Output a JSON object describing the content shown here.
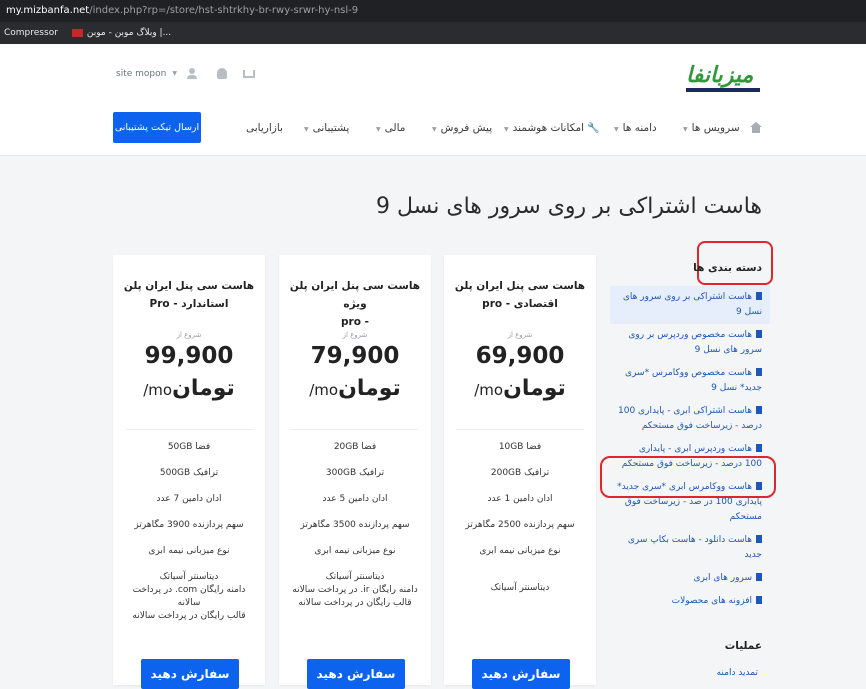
{
  "browser": {
    "url_host": "my.mizbanfa.net",
    "url_path": "/index.php?rp=/store/hst-shtrkhy-br-rwy-srwr-hy-nsl-9"
  },
  "bookmarks": [
    {
      "label": "Compressor"
    },
    {
      "label": "وبلاگ موبن - موبن |..."
    }
  ],
  "header": {
    "logo_text": "میزبانفا",
    "account_label": "site mopon",
    "ticket_button": "ارسال تیکت پشتیبانی",
    "nav": [
      {
        "label": "سرویس ها",
        "has_caret": true
      },
      {
        "label": "دامنه ها",
        "has_caret": true
      },
      {
        "label": "امکانات هوشمند",
        "has_caret": true
      },
      {
        "label": "پیش فروش",
        "has_caret": true
      },
      {
        "label": "مالی",
        "has_caret": true
      },
      {
        "label": "پشتیبانی",
        "has_caret": true
      },
      {
        "label": "بازاریابی",
        "has_caret": false
      }
    ]
  },
  "page": {
    "title": "هاست اشتراکی بر روی سرور های نسل 9"
  },
  "sidebar": {
    "categories_heading": "دسته بندی ها",
    "categories": [
      {
        "label": "هاست اشتراکی بر روی سرور های نسل 9",
        "active": true
      },
      {
        "label": "هاست مخصوص وردپرس بر روی سرور های نسل 9",
        "active": false
      },
      {
        "label": "هاست مخصوص ووکامرس *سری جدید* نسل 9",
        "active": false
      },
      {
        "label": "هاست اشتراکی ابری - پایداری 100 درصد - زیرساخت فوق مستحکم",
        "active": false
      },
      {
        "label": "هاست وردپرس ابری - پایداری 100 درصد - زیرساخت فوق مستحکم",
        "active": false
      },
      {
        "label": "هاست ووکامرس ابری *سری جدید* پایداری 100 در صد - زیرساخت فوق مستحکم",
        "active": false
      },
      {
        "label": "هاست دانلود - هاست بکاپ سری جدید",
        "active": false
      },
      {
        "label": "سرور های ابری",
        "active": false
      },
      {
        "label": "افزونه های محصولات",
        "active": false
      }
    ],
    "ops_heading": "عملیات",
    "ops_item": "تمدید دامنه"
  },
  "products": [
    {
      "title_line1": "هاست سی پنل ایران پلن",
      "title_line2": "اقتصادی - pro",
      "from_label": "شروع از",
      "price": "69,900",
      "currency": "تومان",
      "period": "/mo",
      "features": [
        "فضا 10GB",
        "ترافیک 200GB",
        "ادان دامین 1 عدد",
        "سهم پردازنده 2500 مگاهرتز",
        "نوع میزبانی نیمه ابری",
        "دیتاسنتر آسیاتک"
      ],
      "order_label": "سفارش دهید"
    },
    {
      "title_line1": "هاست سی پنل ایران پلن ویژه",
      "title_line2": "- pro",
      "from_label": "شروع از",
      "price": "79,900",
      "currency": "تومان",
      "period": "/mo",
      "features": [
        "فضا 20GB",
        "ترافیک 300GB",
        "ادان دامین 5 عدد",
        "سهم پردازنده 3500 مگاهرتز",
        "نوع میزبانی نیمه ابری",
        "دیتاسنتر آسیاتک",
        "دامنه رایگان ir. در پرداخت سالانه",
        "قالب رایگان در پرداخت سالانه"
      ],
      "order_label": "سفارش دهید"
    },
    {
      "title_line1": "هاست سی پنل ایران پلن",
      "title_line2": "استاندارد - Pro",
      "from_label": "شروع از",
      "price": "99,900",
      "currency": "تومان",
      "period": "/mo",
      "features": [
        "فضا 50GB",
        "ترافیک 500GB",
        "ادان دامین 7 عدد",
        "سهم پردازنده 3900 مگاهرتز",
        "نوع میزبانی نیمه ابری",
        "دیتاسنتر آسیاتک",
        "دامنه رایگان com. در پرداخت سالانه",
        "قالب رایگان در پرداخت سالانه"
      ],
      "order_label": "سفارش دهید"
    }
  ],
  "colors": {
    "primary": "#0d63ee",
    "link": "#1e57b8",
    "annotation_red": "#e0262b",
    "logo_green": "#2e9a3a"
  }
}
